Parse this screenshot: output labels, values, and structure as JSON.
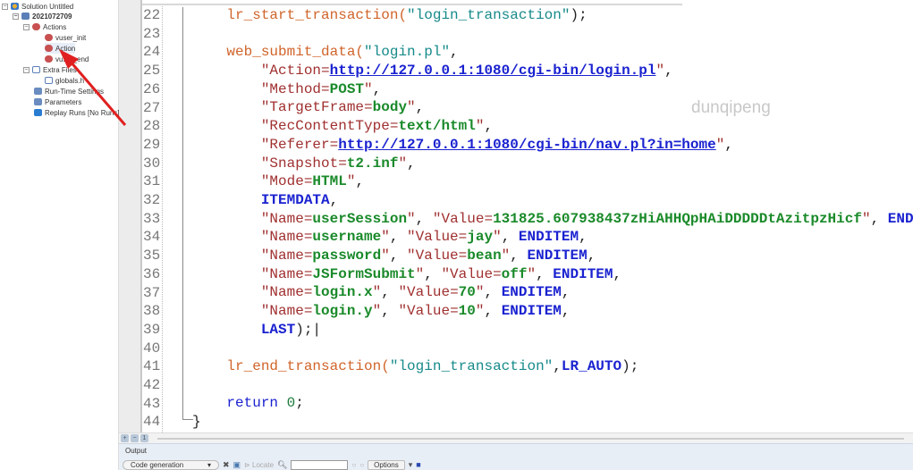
{
  "tree": {
    "solution": "Solution Untitled",
    "script": "2021072709",
    "actions": "Actions",
    "vuser_init": "vuser_init",
    "action": "Action",
    "vuser_end": "vuser_end",
    "extra_files": "Extra Files",
    "globals": "globals.h",
    "runtime": "Run-Time Settings",
    "parameters": "Parameters",
    "replay": "Replay Runs [No Runs]"
  },
  "editor": {
    "line_numbers": [
      "22",
      "23",
      "24",
      "25",
      "26",
      "27",
      "28",
      "29",
      "30",
      "31",
      "32",
      "33",
      "34",
      "35",
      "36",
      "37",
      "38",
      "39",
      "40",
      "41",
      "42",
      "43",
      "44"
    ],
    "lines": [
      [
        [
          "    ",
          ""
        ],
        [
          "lr_start_transaction(",
          "fn"
        ],
        [
          "\"login_transaction\"",
          "str"
        ],
        [
          ");",
          ""
        ]
      ],
      [],
      [
        [
          "    ",
          ""
        ],
        [
          "web_submit_data(",
          "fn"
        ],
        [
          "\"login.pl\"",
          "str"
        ],
        [
          ",",
          ""
        ]
      ],
      [
        [
          "        ",
          ""
        ],
        [
          "\"Action=",
          "q"
        ],
        [
          "http://127.0.0.1:1080/cgi-bin/login.pl",
          "url"
        ],
        [
          "\"",
          "q"
        ],
        [
          ",",
          ""
        ]
      ],
      [
        [
          "        ",
          ""
        ],
        [
          "\"Method=",
          "q"
        ],
        [
          "POST",
          "v"
        ],
        [
          "\"",
          "q"
        ],
        [
          ",",
          ""
        ]
      ],
      [
        [
          "        ",
          ""
        ],
        [
          "\"TargetFrame=",
          "q"
        ],
        [
          "body",
          "v"
        ],
        [
          "\"",
          "q"
        ],
        [
          ",",
          ""
        ]
      ],
      [
        [
          "        ",
          ""
        ],
        [
          "\"RecContentType=",
          "q"
        ],
        [
          "text/html",
          "v"
        ],
        [
          "\"",
          "q"
        ],
        [
          ",",
          ""
        ]
      ],
      [
        [
          "        ",
          ""
        ],
        [
          "\"Referer=",
          "q"
        ],
        [
          "http://127.0.0.1:1080/cgi-bin/nav.pl?in=home",
          "url"
        ],
        [
          "\"",
          "q"
        ],
        [
          ",",
          ""
        ]
      ],
      [
        [
          "        ",
          ""
        ],
        [
          "\"Snapshot=",
          "q"
        ],
        [
          "t2.inf",
          "v"
        ],
        [
          "\"",
          "q"
        ],
        [
          ",",
          ""
        ]
      ],
      [
        [
          "        ",
          ""
        ],
        [
          "\"Mode=",
          "q"
        ],
        [
          "HTML",
          "v"
        ],
        [
          "\"",
          "q"
        ],
        [
          ",",
          ""
        ]
      ],
      [
        [
          "        ",
          ""
        ],
        [
          "ITEMDATA",
          "kw"
        ],
        [
          ",",
          ""
        ]
      ],
      [
        [
          "        ",
          ""
        ],
        [
          "\"Name=",
          "q"
        ],
        [
          "userSession",
          "v"
        ],
        [
          "\"",
          "q"
        ],
        [
          ", ",
          ""
        ],
        [
          "\"Value=",
          "q"
        ],
        [
          "131825.607938437zHiAHHQpHAiDDDDDtAzitpzHicf",
          "v"
        ],
        [
          "\"",
          "q"
        ],
        [
          ", ",
          ""
        ],
        [
          "ENDITEM",
          "kw"
        ],
        [
          ",",
          ""
        ]
      ],
      [
        [
          "        ",
          ""
        ],
        [
          "\"Name=",
          "q"
        ],
        [
          "username",
          "v"
        ],
        [
          "\"",
          "q"
        ],
        [
          ", ",
          ""
        ],
        [
          "\"Value=",
          "q"
        ],
        [
          "jay",
          "v"
        ],
        [
          "\"",
          "q"
        ],
        [
          ", ",
          ""
        ],
        [
          "ENDITEM",
          "kw"
        ],
        [
          ",",
          ""
        ]
      ],
      [
        [
          "        ",
          ""
        ],
        [
          "\"Name=",
          "q"
        ],
        [
          "password",
          "v"
        ],
        [
          "\"",
          "q"
        ],
        [
          ", ",
          ""
        ],
        [
          "\"Value=",
          "q"
        ],
        [
          "bean",
          "v"
        ],
        [
          "\"",
          "q"
        ],
        [
          ", ",
          ""
        ],
        [
          "ENDITEM",
          "kw"
        ],
        [
          ",",
          ""
        ]
      ],
      [
        [
          "        ",
          ""
        ],
        [
          "\"Name=",
          "q"
        ],
        [
          "JSFormSubmit",
          "v"
        ],
        [
          "\"",
          "q"
        ],
        [
          ", ",
          ""
        ],
        [
          "\"Value=",
          "q"
        ],
        [
          "off",
          "v"
        ],
        [
          "\"",
          "q"
        ],
        [
          ", ",
          ""
        ],
        [
          "ENDITEM",
          "kw"
        ],
        [
          ",",
          ""
        ]
      ],
      [
        [
          "        ",
          ""
        ],
        [
          "\"Name=",
          "q"
        ],
        [
          "login.x",
          "v"
        ],
        [
          "\"",
          "q"
        ],
        [
          ", ",
          ""
        ],
        [
          "\"Value=",
          "q"
        ],
        [
          "70",
          "v"
        ],
        [
          "\"",
          "q"
        ],
        [
          ", ",
          ""
        ],
        [
          "ENDITEM",
          "kw"
        ],
        [
          ",",
          ""
        ]
      ],
      [
        [
          "        ",
          ""
        ],
        [
          "\"Name=",
          "q"
        ],
        [
          "login.y",
          "v"
        ],
        [
          "\"",
          "q"
        ],
        [
          ", ",
          ""
        ],
        [
          "\"Value=",
          "q"
        ],
        [
          "10",
          "v"
        ],
        [
          "\"",
          "q"
        ],
        [
          ", ",
          ""
        ],
        [
          "ENDITEM",
          "kw"
        ],
        [
          ",",
          ""
        ]
      ],
      [
        [
          "        ",
          ""
        ],
        [
          "LAST",
          "kw"
        ],
        [
          ");|",
          ""
        ]
      ],
      [],
      [
        [
          "    ",
          ""
        ],
        [
          "lr_end_transaction(",
          "fn"
        ],
        [
          "\"login_transaction\"",
          "str"
        ],
        [
          ",",
          ""
        ],
        [
          "LR_AUTO",
          "kw"
        ],
        [
          ");",
          ""
        ]
      ],
      [],
      [
        [
          "    ",
          ""
        ],
        [
          "return",
          "kwn"
        ],
        [
          " ",
          ""
        ],
        [
          "0",
          "num"
        ],
        [
          ";",
          ""
        ]
      ],
      [
        [
          "",
          ""
        ],
        [
          "}",
          ""
        ]
      ]
    ]
  },
  "watermark": "dunqipeng",
  "output": {
    "title": "Output",
    "filter": "Code generation",
    "locate": "Locate",
    "search_value": "",
    "options": "Options"
  },
  "zoom_level": "1",
  "colors": {
    "function": "#d0642a",
    "string": "#178a8a",
    "keyword": "#1a22d0",
    "value": "#1a8a2a",
    "arrow": "#e02020"
  }
}
